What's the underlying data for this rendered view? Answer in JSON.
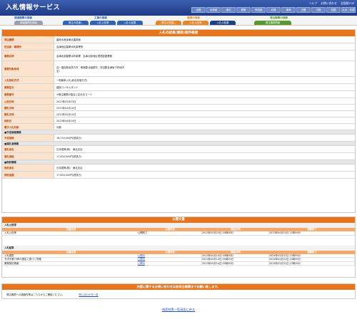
{
  "header": {
    "app_title": "入札情報サービス",
    "links": [
      "ヘルプ",
      "お問い合わせ",
      "全国版TOP"
    ],
    "regions": [
      "全国",
      "北海道",
      "東北",
      "関東",
      "甲信越",
      "北陸",
      "東海",
      "近畿",
      "中国",
      "四国",
      "九州・沖縄"
    ]
  },
  "nav": {
    "groups": [
      {
        "label": "調達機関の検索",
        "color": "#2f63b3"
      },
      {
        "label": "工事の検索",
        "color": "#2f63b3"
      },
      {
        "label": "業務の検索",
        "color": "#e8862a"
      },
      {
        "label": "発注機関の検索",
        "color": "#5a9a2c"
      }
    ],
    "tabs": [
      "調達機関を検索",
      "発注の見通し",
      "入札公告等",
      "入札の結果",
      "発注の見通し",
      "入札公告等",
      "入札の結果",
      "発注機関情報"
    ]
  },
  "detail": {
    "title": "入札の結果(業務)案件概要",
    "rows": [
      {
        "k": "発注機関",
        "v": "農林水産省東北農政局"
      },
      {
        "k": "担当部・事務所",
        "v": "会津地区農業水利事業所"
      },
      {
        "k": "業務名称",
        "v": "会津北部農業水利事業　会津北部地区環境配慮業務"
      },
      {
        "k": "業務対象地域",
        "v": "自）福島県喜多方市、耶麻郡北塩原村、河沼郡会津坂下町地内\n至）"
      },
      {
        "k": "入札契約方式",
        "v": "一般競争入札(総合評価方式)"
      },
      {
        "k": "業務区分",
        "v": "建設コンサルタント"
      },
      {
        "k": "業務番号",
        "v": "※発注機関が独自に定めるコード"
      },
      {
        "k": "公告日時",
        "v": "2023年02月23日"
      },
      {
        "k": "開札日時",
        "v": "2023年04月10日"
      },
      {
        "k": "開札日時",
        "v": "2023年04月10日"
      },
      {
        "k": "契約日",
        "v": "2023年04月14日"
      },
      {
        "k": "電子入札対象",
        "v": "対象"
      }
    ],
    "sec_price": "■予定価格情報",
    "price_rows": [
      {
        "k": "予定価格",
        "v": "18,750,000円(税抜き)"
      }
    ],
    "sec_winner": "■落札者情報",
    "winner_rows": [
      {
        "k": "落札者名",
        "v": "日本振興(株)　東北支店"
      },
      {
        "k": "落札価格",
        "v": "17,650,000円(税抜き)"
      }
    ],
    "sec_contract": "■契約情報",
    "contract_rows": [
      {
        "k": "契約者名",
        "v": "日本振興(株)　東北支店"
      },
      {
        "k": "契約金額",
        "v": "17,650,000円(税抜き)"
      }
    ]
  },
  "announcements": {
    "title": "公開文書",
    "sections": [
      {
        "name": "入札公告等",
        "headers": [
          "文書名称",
          "公開状況",
          "開始日時",
          "掲載終了"
        ],
        "rows": [
          [
            "入札公告等",
            "公開終了",
            "2023年02月23日 00時00分",
            "2023年04月10日 23時59分"
          ]
        ]
      },
      {
        "name": "入札結果",
        "headers": [
          "文書名称",
          "公開状況",
          "開始日時",
          "掲載終了"
        ],
        "rows": [
          [
            "入札調書",
            "公開中",
            "2023年04月14日 00時00分",
            "2024年03月31日 23時59分"
          ],
          [
            "予決令第79条の規定に基づく資格",
            "公開中",
            "2023年04月14日 00時00分",
            "2024年03月31日 23時59分"
          ],
          [
            "業務契約情報",
            "公開中",
            "2023年04月14日 00時00分",
            "2024年03月31日 23時59分"
          ]
        ]
      }
    ]
  },
  "footer": {
    "notice_title": "内容に関するお問い合わせは各発注機関までお願い致します。",
    "notice_text": "発注機関への連絡先等はこちらからご確認ください。",
    "contact_link": "問い合わせ先一覧",
    "back_link": "検索結果一覧画面に戻る"
  }
}
